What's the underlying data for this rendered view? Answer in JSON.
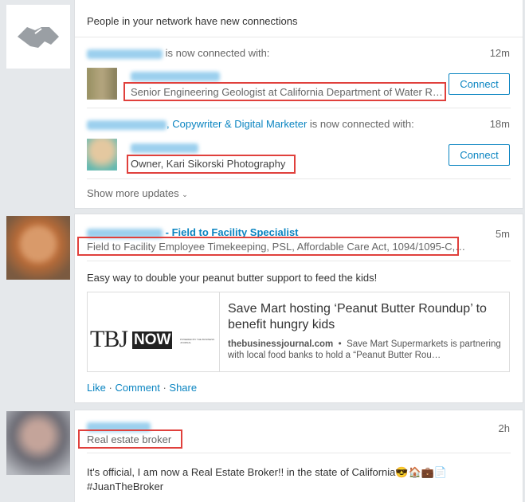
{
  "network_card": {
    "header": "People in your network have new connections",
    "updates": [
      {
        "suffix": "is now connected with:",
        "time": "12m",
        "headline": "Senior Engineering Geologist at California Department of Water R…",
        "button": "Connect"
      },
      {
        "role": ", Copywriter & Digital Marketer",
        "suffix": " is now connected with:",
        "time": "18m",
        "headline": "Owner, Kari Sikorski Photography",
        "button": "Connect"
      }
    ],
    "show_more": "Show more updates",
    "show_more_icon": "chevron-down-icon"
  },
  "post1": {
    "title": "- Field to Facility Specialist",
    "time": "5m",
    "headline": "Field to Facility Employee Timekeeping, PSL, Affordable Care Act, 1094/1095-C,…",
    "text": "Easy way to double your peanut butter support to feed the kids!",
    "article": {
      "logo": "TBJNOW",
      "logo_small": "POWERED BY THE BUSINESS JOURNAL",
      "title": "Save Mart hosting ‘Peanut Butter Roundup’ to benefit hungry kids",
      "source": "thebusinessjournal.com",
      "summary": "Save Mart Supermarkets is partnering with local food banks to hold a “Peanut Butter Rou…"
    },
    "actions": {
      "like": "Like",
      "comment": "Comment",
      "share": "Share"
    }
  },
  "post2": {
    "time": "2h",
    "headline": "Real estate broker",
    "text": "It's official, I am now a Real Estate Broker!! in the state of California😎🏠💼📄",
    "hashtag": "#JuanTheBroker"
  },
  "colors": {
    "link": "#0a84c1",
    "highlight": "#e0403c",
    "background": "#e5e8eb"
  }
}
